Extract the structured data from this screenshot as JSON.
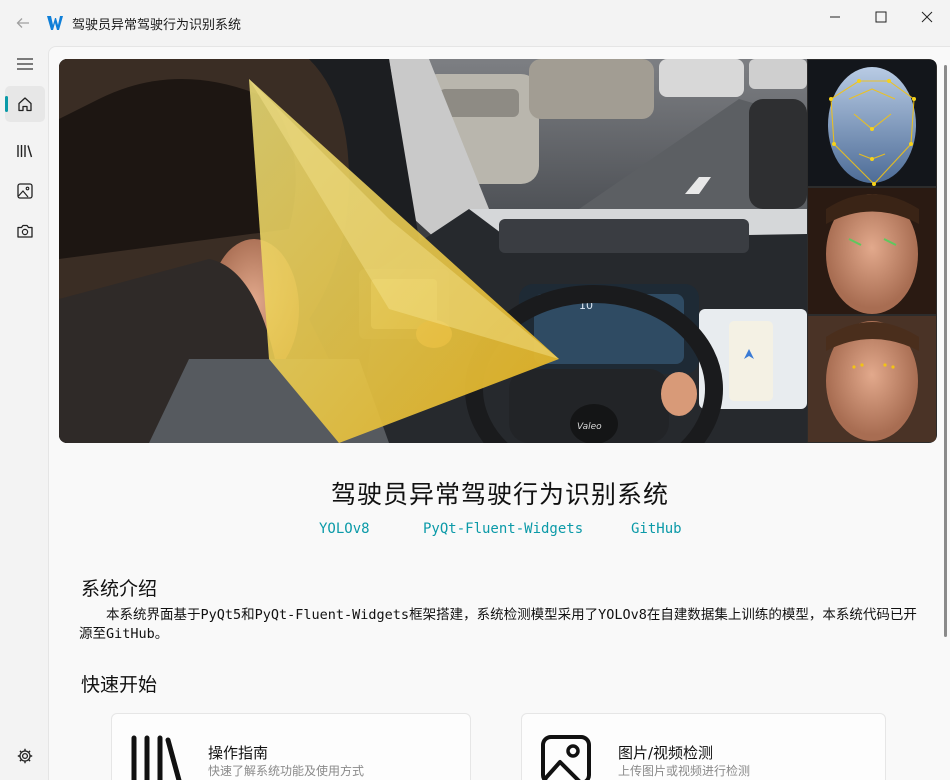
{
  "window": {
    "title": "驾驶员异常驾驶行为识别系统",
    "back_icon": "back-arrow-icon",
    "controls": [
      "minimize-icon",
      "maximize-icon",
      "close-icon"
    ]
  },
  "nav": {
    "items": [
      {
        "icon": "menu-icon",
        "active": false
      },
      {
        "icon": "home-icon",
        "active": true
      },
      {
        "icon": "library-icon",
        "active": false
      },
      {
        "icon": "image-icon",
        "active": false
      },
      {
        "icon": "camera-icon",
        "active": false
      }
    ],
    "footer_icon": "settings-icon"
  },
  "banner": {
    "logo_text": "Valeo",
    "dash_speed": "10"
  },
  "home": {
    "title": "驾驶员异常驾驶行为识别系统",
    "links": [
      "YOLOv8",
      "PyQt-Fluent-Widgets",
      "GitHub"
    ],
    "intro_heading": "系统介绍",
    "intro_text": "本系统界面基于PyQt5和PyQt-Fluent-Widgets框架搭建，系统检测模型采用了YOLOv8在自建数据集上训练的模型，本系统代码已开源至GitHub。",
    "quick_heading": "快速开始",
    "cards": [
      {
        "icon": "library-icon",
        "title": "操作指南",
        "desc": "快速了解系统功能及使用方式"
      },
      {
        "icon": "image-icon",
        "title": "图片/视频检测",
        "desc": "上传图片或视频进行检测"
      }
    ]
  },
  "colors": {
    "accent": "#0a9aa8",
    "link": "#0b9aa8"
  }
}
